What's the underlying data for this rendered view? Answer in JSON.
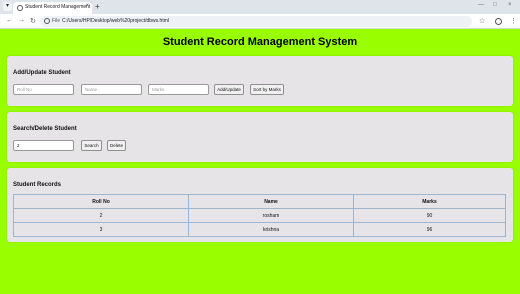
{
  "browser": {
    "tab_title": "Student Record Management",
    "tab_close": "×",
    "new_tab": "+",
    "file_label": "File",
    "url": "C:/Users/HP/Desktop/web%20project/dbws.html",
    "window_controls": {
      "minimize": "—",
      "maximize": "□",
      "close": "×"
    },
    "nav": {
      "back": "←",
      "forward": "→",
      "reload": "↻"
    },
    "star": "☆",
    "menu": "⋮"
  },
  "page": {
    "title": "Student Record Management System"
  },
  "add_section": {
    "heading": "Add/Update Student",
    "roll_placeholder": "Roll No",
    "name_placeholder": "Name",
    "marks_placeholder": "Marks",
    "add_button": "Add/Update",
    "sort_button": "Sort by Marks"
  },
  "search_section": {
    "heading": "Search/Delete Student",
    "roll_value": "2",
    "search_button": "Search",
    "delete_button": "Delete"
  },
  "records": {
    "heading": "Student Records",
    "columns": [
      "Roll No",
      "Name",
      "Marks"
    ],
    "rows": [
      [
        "2",
        "rosham",
        "90"
      ],
      [
        "3",
        "krishna",
        "96"
      ]
    ]
  },
  "colors": {
    "page_background": "#99ff00",
    "card_background": "#e7e4e7",
    "table_border": "#9bb6d0"
  }
}
